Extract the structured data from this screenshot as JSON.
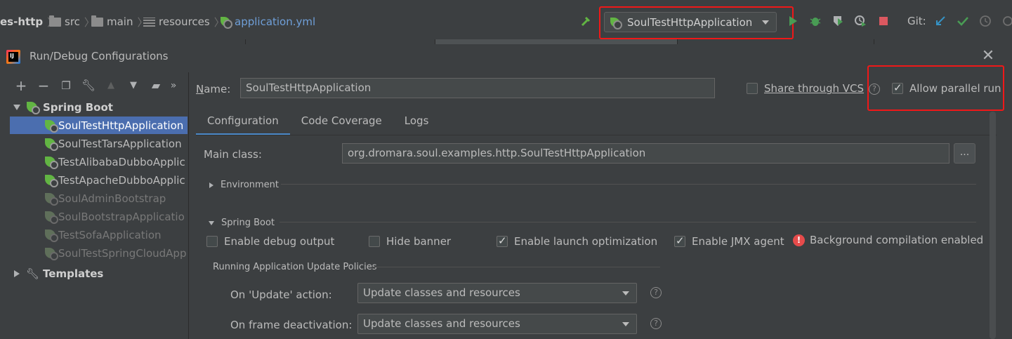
{
  "navbar": {
    "breadcrumbs": [
      "es-http",
      "src",
      "main",
      "resources",
      "application.yml"
    ],
    "run_config": "SoulTestHttpApplication",
    "git_label": "Git:"
  },
  "dialog": {
    "title": "Run/Debug Configurations",
    "tree": {
      "groups": [
        {
          "label": "Spring Boot",
          "items": [
            {
              "label": "SoulTestHttpApplication",
              "selected": true
            },
            {
              "label": "SoulTestTarsApplication"
            },
            {
              "label": "TestAlibabaDubboApplic"
            },
            {
              "label": "TestApacheDubboApplic"
            },
            {
              "label": "SoulAdminBootstrap"
            },
            {
              "label": "SoulBootstrapApplicatio"
            },
            {
              "label": "TestSofaApplication"
            },
            {
              "label": "SoulTestSpringCloudApp"
            }
          ]
        },
        {
          "label": "Templates"
        }
      ]
    },
    "name_label": "Name:",
    "name_value": "SoulTestHttpApplication",
    "share_vcs_label": "Share through VCS",
    "share_vcs_checked": false,
    "allow_parallel_label": "Allow parallel run",
    "allow_parallel_checked": true,
    "tabs": [
      "Configuration",
      "Code Coverage",
      "Logs"
    ],
    "active_tab": "Configuration",
    "main_class_label": "Main class:",
    "main_class_value": "org.dromara.soul.examples.http.SoulTestHttpApplication",
    "browse_button": "...",
    "environment_section": "Environment",
    "springboot_section": "Spring Boot",
    "options": [
      {
        "label": "Enable debug output",
        "checked": false
      },
      {
        "label": "Hide banner",
        "checked": false
      },
      {
        "label": "Enable launch optimization",
        "checked": true
      },
      {
        "label": "Enable JMX agent",
        "checked": true
      }
    ],
    "bg_compilation": "Background compilation enabled",
    "update_policies_title": "Running Application Update Policies",
    "on_update_label": "On 'Update' action:",
    "on_update_value": "Update classes and resources",
    "on_frame_label": "On frame deactivation:",
    "on_frame_value": "Update classes and resources"
  },
  "colors": {
    "background": "#3c3f41",
    "selection": "#4b6eaf",
    "highlight_box": "#f01818",
    "spring_green": "#62b543",
    "error_red": "#e64b4b"
  }
}
